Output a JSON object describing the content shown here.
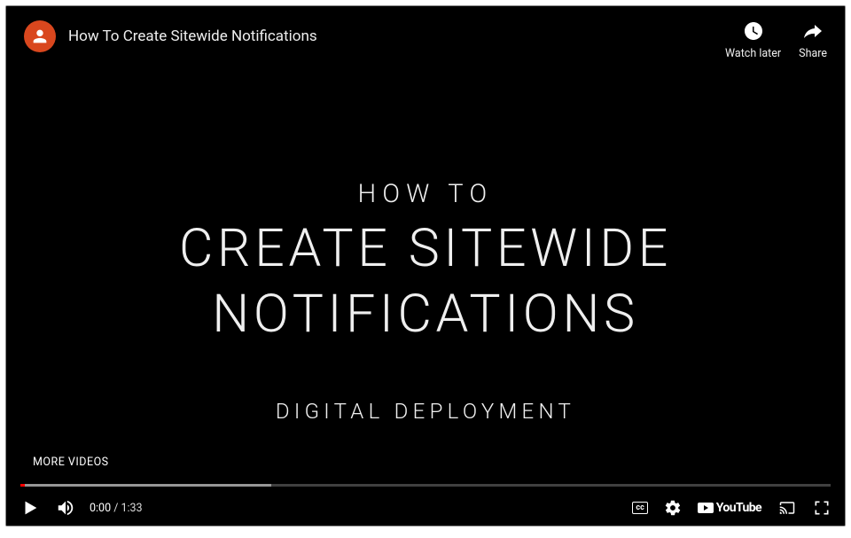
{
  "header": {
    "title": "How To Create Sitewide Notifications",
    "actions": {
      "watch_later": "Watch later",
      "share": "Share"
    }
  },
  "content": {
    "line1": "HOW TO",
    "line2": "CREATE SITEWIDE",
    "line3": "NOTIFICATIONS",
    "line4": "DIGITAL DEPLOYMENT"
  },
  "more_videos_label": "MORE VIDEOS",
  "progress": {
    "buffered_percent": 31,
    "played_percent": 0.5
  },
  "controls": {
    "time_current": "0:00",
    "time_separator": " / ",
    "time_total": "1:33",
    "cc_label": "cc",
    "youtube_label": "YouTube"
  }
}
